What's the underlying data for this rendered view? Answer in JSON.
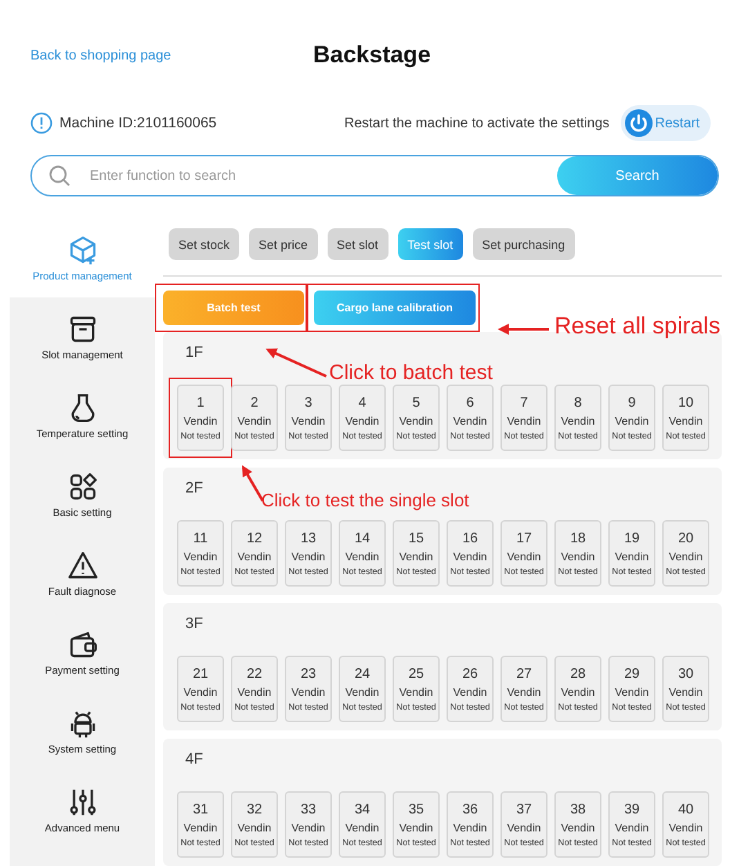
{
  "header": {
    "back_link": "Back to shopping page",
    "title": "Backstage"
  },
  "machine": {
    "id_label": "Machine ID:2101160065",
    "notice": "Restart the machine to activate the settings",
    "restart": "Restart"
  },
  "search": {
    "placeholder": "Enter function to search",
    "button": "Search"
  },
  "sidebar": {
    "items": [
      {
        "label": "Product management",
        "selected": true
      },
      {
        "label": "Slot management",
        "selected": false
      },
      {
        "label": "Temperature setting",
        "selected": false
      },
      {
        "label": "Basic setting",
        "selected": false
      },
      {
        "label": "Fault diagnose",
        "selected": false
      },
      {
        "label": "Payment setting",
        "selected": false
      },
      {
        "label": "System setting",
        "selected": false
      },
      {
        "label": "Advanced menu",
        "selected": false
      }
    ]
  },
  "tabs": [
    {
      "label": "Set stock",
      "selected": false
    },
    {
      "label": "Set price",
      "selected": false
    },
    {
      "label": "Set slot",
      "selected": false
    },
    {
      "label": "Test slot",
      "selected": true
    },
    {
      "label": "Set purchasing",
      "selected": false
    }
  ],
  "actions": [
    {
      "label": "Batch test",
      "kind": "orange",
      "marked": true
    },
    {
      "label": "Cargo lane calibration",
      "kind": "blue",
      "marked": true
    }
  ],
  "floors": [
    {
      "title": "1F",
      "slots": [
        {
          "number": "1",
          "name": "Vendin",
          "status": "Not tested",
          "marked": true
        },
        {
          "number": "2",
          "name": "Vendin",
          "status": "Not tested",
          "marked": false
        },
        {
          "number": "3",
          "name": "Vendin",
          "status": "Not tested",
          "marked": false
        },
        {
          "number": "4",
          "name": "Vendin",
          "status": "Not tested",
          "marked": false
        },
        {
          "number": "5",
          "name": "Vendin",
          "status": "Not tested",
          "marked": false
        },
        {
          "number": "6",
          "name": "Vendin",
          "status": "Not tested",
          "marked": false
        },
        {
          "number": "7",
          "name": "Vendin",
          "status": "Not tested",
          "marked": false
        },
        {
          "number": "8",
          "name": "Vendin",
          "status": "Not tested",
          "marked": false
        },
        {
          "number": "9",
          "name": "Vendin",
          "status": "Not tested",
          "marked": false
        },
        {
          "number": "10",
          "name": "Vendin",
          "status": "Not tested",
          "marked": false
        }
      ]
    },
    {
      "title": "2F",
      "slots": [
        {
          "number": "11",
          "name": "Vendin",
          "status": "Not tested",
          "marked": false
        },
        {
          "number": "12",
          "name": "Vendin",
          "status": "Not tested",
          "marked": false
        },
        {
          "number": "13",
          "name": "Vendin",
          "status": "Not tested",
          "marked": false
        },
        {
          "number": "14",
          "name": "Vendin",
          "status": "Not tested",
          "marked": false
        },
        {
          "number": "15",
          "name": "Vendin",
          "status": "Not tested",
          "marked": false
        },
        {
          "number": "16",
          "name": "Vendin",
          "status": "Not tested",
          "marked": false
        },
        {
          "number": "17",
          "name": "Vendin",
          "status": "Not tested",
          "marked": false
        },
        {
          "number": "18",
          "name": "Vendin",
          "status": "Not tested",
          "marked": false
        },
        {
          "number": "19",
          "name": "Vendin",
          "status": "Not tested",
          "marked": false
        },
        {
          "number": "20",
          "name": "Vendin",
          "status": "Not tested",
          "marked": false
        }
      ]
    },
    {
      "title": "3F",
      "slots": [
        {
          "number": "21",
          "name": "Vendin",
          "status": "Not tested",
          "marked": false
        },
        {
          "number": "22",
          "name": "Vendin",
          "status": "Not tested",
          "marked": false
        },
        {
          "number": "23",
          "name": "Vendin",
          "status": "Not tested",
          "marked": false
        },
        {
          "number": "24",
          "name": "Vendin",
          "status": "Not tested",
          "marked": false
        },
        {
          "number": "25",
          "name": "Vendin",
          "status": "Not tested",
          "marked": false
        },
        {
          "number": "26",
          "name": "Vendin",
          "status": "Not tested",
          "marked": false
        },
        {
          "number": "27",
          "name": "Vendin",
          "status": "Not tested",
          "marked": false
        },
        {
          "number": "28",
          "name": "Vendin",
          "status": "Not tested",
          "marked": false
        },
        {
          "number": "29",
          "name": "Vendin",
          "status": "Not tested",
          "marked": false
        },
        {
          "number": "30",
          "name": "Vendin",
          "status": "Not tested",
          "marked": false
        }
      ]
    },
    {
      "title": "4F",
      "slots": [
        {
          "number": "31",
          "name": "Vendin",
          "status": "Not tested",
          "marked": false
        },
        {
          "number": "32",
          "name": "Vendin",
          "status": "Not tested",
          "marked": false
        },
        {
          "number": "33",
          "name": "Vendin",
          "status": "Not tested",
          "marked": false
        },
        {
          "number": "34",
          "name": "Vendin",
          "status": "Not tested",
          "marked": false
        },
        {
          "number": "35",
          "name": "Vendin",
          "status": "Not tested",
          "marked": false
        },
        {
          "number": "36",
          "name": "Vendin",
          "status": "Not tested",
          "marked": false
        },
        {
          "number": "37",
          "name": "Vendin",
          "status": "Not tested",
          "marked": false
        },
        {
          "number": "38",
          "name": "Vendin",
          "status": "Not tested",
          "marked": false
        },
        {
          "number": "39",
          "name": "Vendin",
          "status": "Not tested",
          "marked": false
        },
        {
          "number": "40",
          "name": "Vendin",
          "status": "Not tested",
          "marked": false
        }
      ]
    }
  ],
  "annotations": [
    {
      "text": "Reset all spirals"
    },
    {
      "text": "Click to batch test"
    },
    {
      "text": "Click to test the single slot"
    }
  ]
}
